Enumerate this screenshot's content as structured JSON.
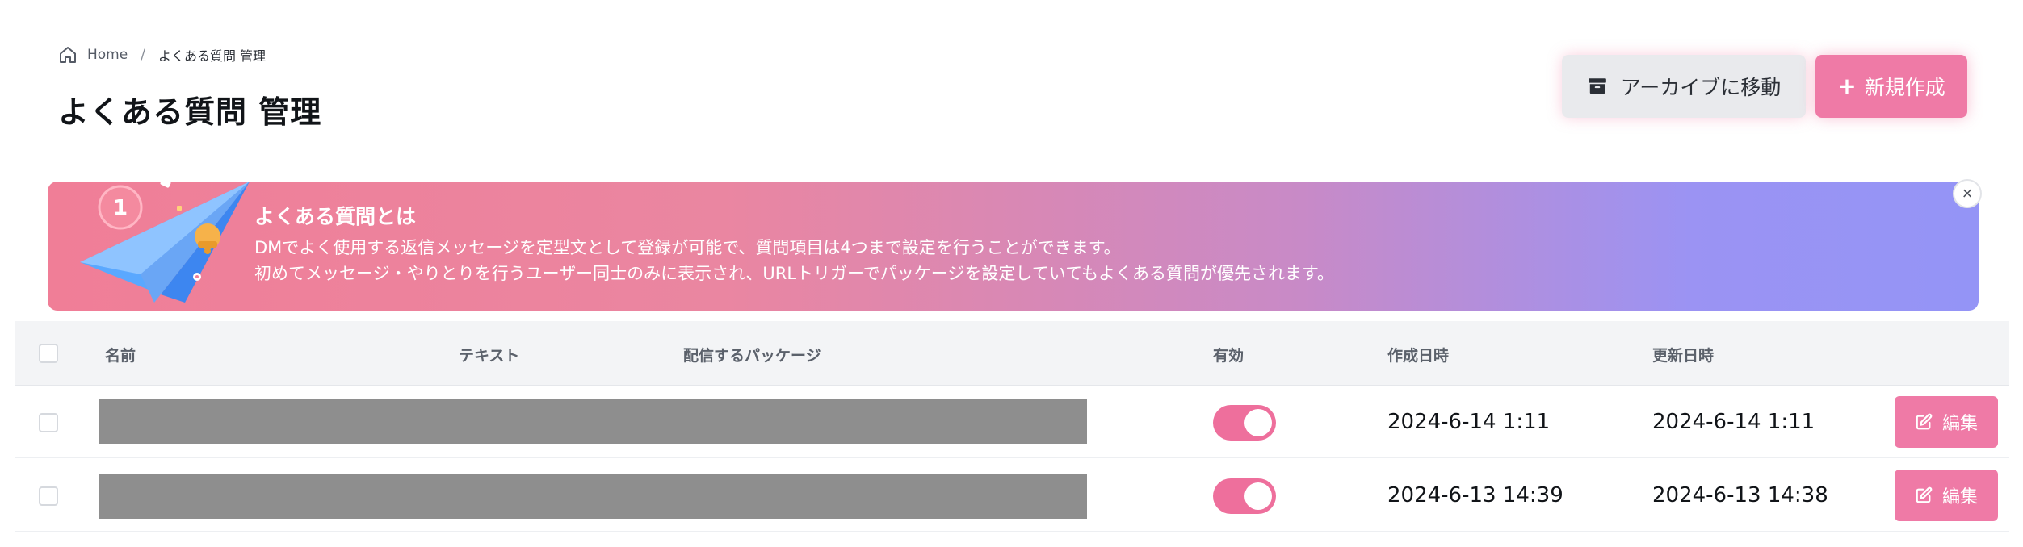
{
  "breadcrumb": {
    "home": "Home",
    "separator": "/",
    "current": "よくある質問 管理"
  },
  "page_title": "よくある質問 管理",
  "actions": {
    "archive_label": "アーカイブに移動",
    "new_label": "新規作成",
    "new_icon": "+"
  },
  "banner": {
    "title": "よくある質問とは",
    "line1": "DMでよく使用する返信メッセージを定型文として登録が可能で、質問項目は4つまで設定を行うことができます。",
    "line2": "初めてメッセージ・やりとりを行うユーザー同士のみに表示され、URLトリガーでパッケージを設定していてもよくある質問が優先されます。",
    "badge_number": "1",
    "close_icon": "×",
    "gradient_start": "#f07e97",
    "gradient_end": "#9494f6"
  },
  "table": {
    "headers": {
      "name": "名前",
      "text": "テキスト",
      "package": "配信するパッケージ",
      "enabled": "有効",
      "created": "作成日時",
      "updated": "更新日時"
    },
    "rows": [
      {
        "name": "",
        "text": "",
        "package": "",
        "enabled": true,
        "created": "2024-6-14 1:11",
        "updated": "2024-6-14 1:11",
        "edit_label": "編集"
      },
      {
        "name": "",
        "text": "",
        "package": "",
        "enabled": true,
        "created": "2024-6-13 14:39",
        "updated": "2024-6-13 14:38",
        "edit_label": "編集"
      }
    ]
  },
  "colors": {
    "accent": "#ef7aa6",
    "toggle_on": "#ee6f9c",
    "archive_bg": "#e9eaed"
  }
}
